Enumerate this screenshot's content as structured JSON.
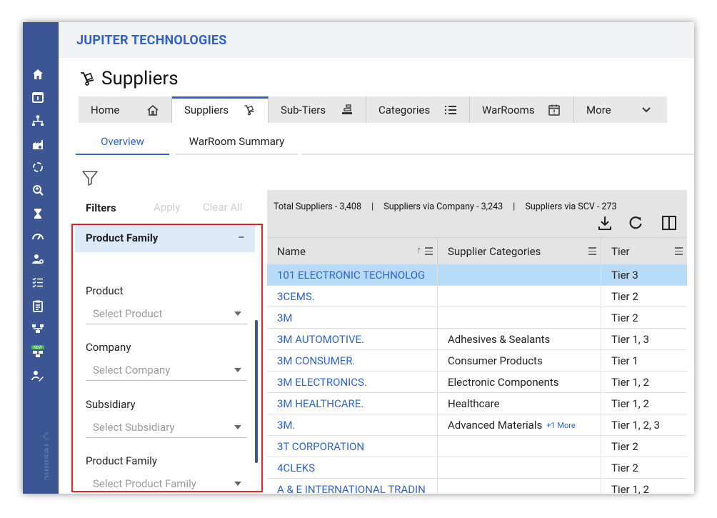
{
  "app": {
    "title": "JUPITER TECHNOLOGIES",
    "brand_watermark": "resilinc"
  },
  "page": {
    "title": "Suppliers"
  },
  "tabs": [
    {
      "label": "Home",
      "icon": "home-icon"
    },
    {
      "label": "Suppliers",
      "icon": "supplier-cart-icon",
      "active": true
    },
    {
      "label": "Sub-Tiers",
      "icon": "subtier-icon"
    },
    {
      "label": "Categories",
      "icon": "list-icon"
    },
    {
      "label": "WarRooms",
      "icon": "calendar-alert-icon"
    },
    {
      "label": "More",
      "icon": "chevron-down-icon"
    }
  ],
  "subtabs": [
    {
      "label": "Overview",
      "active": true
    },
    {
      "label": "WarRoom Summary"
    }
  ],
  "filters": {
    "title": "Filters",
    "apply": "Apply",
    "clear": "Clear All",
    "section": "Product Family",
    "collapse_symbol": "–",
    "fields": [
      {
        "label": "Product",
        "placeholder": "Select Product"
      },
      {
        "label": "Company",
        "placeholder": "Select Company"
      },
      {
        "label": "Subsidiary",
        "placeholder": "Select Subsidiary"
      },
      {
        "label": "Product Family",
        "placeholder": "Select Product Family"
      }
    ]
  },
  "summary": {
    "total": "Total Suppliers - 3,408",
    "sep1": "|",
    "company": "Suppliers via Company - 3,243",
    "sep2": "|",
    "scv": "Suppliers via SCV - 273"
  },
  "grid": {
    "columns": [
      "Name",
      "Supplier Categories",
      "Tier"
    ],
    "sort_indicator": "↑",
    "rows": [
      {
        "name": "101 ELECTRONIC TECHNOLOG",
        "category": "",
        "more": "",
        "tier": "Tier 3",
        "selected": true
      },
      {
        "name": "3CEMS.",
        "category": "",
        "more": "",
        "tier": "Tier 2"
      },
      {
        "name": "3M",
        "category": "",
        "more": "",
        "tier": "Tier 2"
      },
      {
        "name": "3M AUTOMOTIVE.",
        "category": "Adhesives & Sealants",
        "more": "",
        "tier": "Tier 1, 3"
      },
      {
        "name": "3M CONSUMER.",
        "category": "Consumer Products",
        "more": "",
        "tier": "Tier 1"
      },
      {
        "name": "3M ELECTRONICS.",
        "category": "Electronic Components",
        "more": "",
        "tier": "Tier 1, 2"
      },
      {
        "name": "3M HEALTHCARE.",
        "category": "Healthcare",
        "more": "",
        "tier": "Tier 1, 2"
      },
      {
        "name": "3M.",
        "category": "Advanced Materials",
        "more": "+1 More",
        "tier": "Tier 1, 2, 3"
      },
      {
        "name": "3T CORPORATION",
        "category": "",
        "more": "",
        "tier": "Tier 2"
      },
      {
        "name": "4CLEKS",
        "category": "",
        "more": "",
        "tier": "Tier 2"
      },
      {
        "name": "A & E INTERNATIONAL TRADIN",
        "category": "",
        "more": "",
        "tier": "Tier 1, 2"
      }
    ]
  },
  "colors": {
    "accent": "#2f62c8",
    "sidebar": "#3b5692",
    "highlight": "#e0262b",
    "selected_row": "#b8dcf7"
  }
}
